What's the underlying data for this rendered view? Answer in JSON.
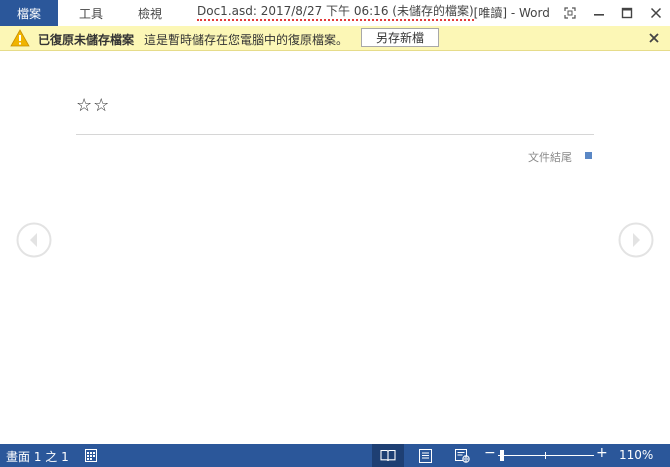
{
  "titlebar": {
    "file_tab": "檔案",
    "tabs": [
      "工具",
      "檢視"
    ],
    "document_title": "Doc1.asd: 2017/8/27 下午 06:16 (未儲存的檔案)",
    "readonly_suffix": " [唯讀] - Word",
    "window_controls": [
      "fullscreen-icon",
      "minimize-icon",
      "maximize-icon",
      "close-icon"
    ]
  },
  "infobar": {
    "icon": "warning-icon",
    "title": "已復原未儲存檔案",
    "message": "這是暫時儲存在您電腦中的復原檔案。",
    "save_as_button": "另存新檔",
    "close_icon": "close-icon"
  },
  "document": {
    "content": "☆☆",
    "end_of_document": "文件結尾"
  },
  "navigation": {
    "prev_icon": "chevron-left-icon",
    "next_icon": "chevron-right-icon"
  },
  "statusbar": {
    "page_count": "畫面 1 之 1",
    "zoom_level": "110%",
    "zoom_minus": "−",
    "zoom_plus": "+",
    "zoom_percent": 110
  },
  "colors": {
    "accent": "#2b579a",
    "infobar_bg": "#fcf7b6",
    "warning": "#f0b400",
    "end_marker": "#5a87c5"
  }
}
